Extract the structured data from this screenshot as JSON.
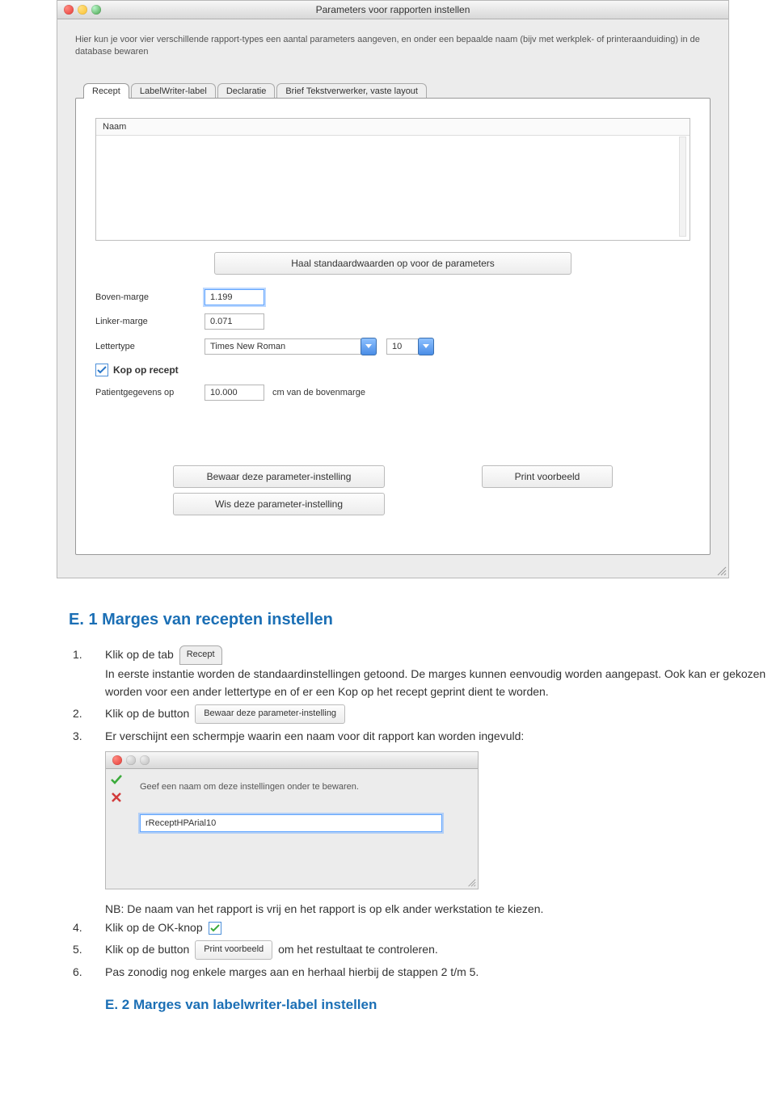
{
  "window": {
    "title": "Parameters voor rapporten instellen",
    "intro": "Hier kun je voor vier verschillende rapport-types een aantal parameters aangeven, en onder een bepaalde naam (bijv met werkplek- of printeraanduiding) in de database bewaren",
    "tabs": [
      "Recept",
      "LabelWriter-label",
      "Declaratie",
      "Brief Tekstverwerker, vaste layout"
    ],
    "list_header": "Naam",
    "std_btn": "Haal standaardwaarden op voor de parameters",
    "fields": {
      "boven_label": "Boven-marge",
      "boven_value": "1.199",
      "linker_label": "Linker-marge",
      "linker_value": "0.071",
      "letter_label": "Lettertype",
      "font": "Times New Roman",
      "size": "10",
      "kop_label": "Kop op recept",
      "patient_label": "Patientgegevens op",
      "patient_value": "10.000",
      "patient_suffix": "cm van de bovenmarge"
    },
    "buttons": {
      "save": "Bewaar deze parameter-instelling",
      "clear": "Wis deze parameter-instelling",
      "preview": "Print voorbeeld"
    }
  },
  "doc": {
    "heading1": "E. 1 Marges van recepten instellen",
    "step1a": "Klik op de tab",
    "step1_tab": "Recept",
    "step1b": "In eerste instantie worden de standaardinstellingen getoond. De marges kunnen eenvoudig worden aangepast. Ook kan er gekozen worden voor een ander lettertype en of er een Kop op het recept geprint dient te worden.",
    "step2a": "Klik op de button",
    "step2_btn": "Bewaar deze parameter-instelling",
    "step3": "Er verschijnt een schermpje waarin een naam voor dit rapport kan worden ingevuld:",
    "nb": "NB: De naam van het rapport is vrij en het rapport is op elk ander werkstation te kiezen.",
    "step4": "Klik op de OK-knop",
    "step5a": "Klik op de button",
    "step5_btn": "Print voorbeeld",
    "step5b": "om het restultaat te controleren.",
    "step6": "Pas zonodig nog enkele marges aan en herhaal hierbij de stappen 2 t/m 5.",
    "heading2": "E. 2 Marges van labelwriter-label  instellen"
  },
  "popup": {
    "message": "Geef een naam om deze instellingen onder te bewaren.",
    "value": "rReceptHPArial10"
  }
}
